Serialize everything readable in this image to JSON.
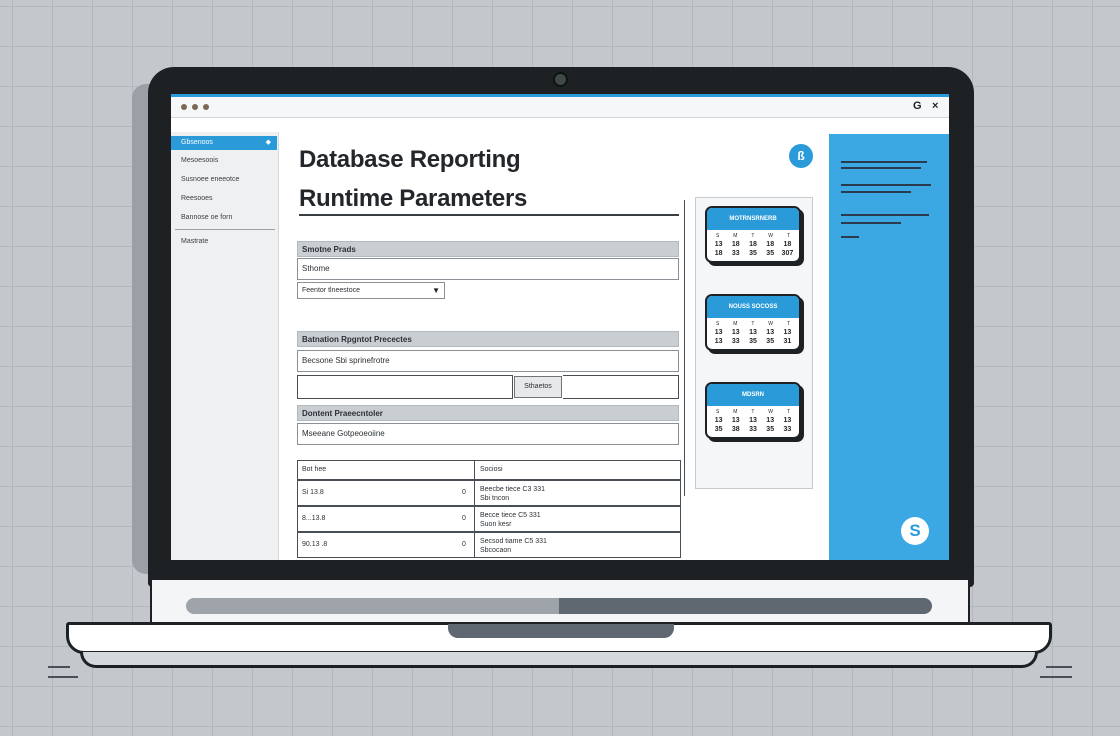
{
  "window": {
    "controls_right": [
      "G",
      "×"
    ]
  },
  "sidebar": {
    "items": [
      {
        "label": "Gbsenoos",
        "active": true
      },
      {
        "label": "Mesoesoois"
      },
      {
        "label": "Susnoee eneeotce"
      },
      {
        "label": "Reesooes"
      },
      {
        "label": "Bannose oe forn"
      },
      {
        "label": "Mastrate"
      }
    ]
  },
  "main": {
    "title_line1": "Database Reporting",
    "title_line2": "Runtime Parameters",
    "help_icon_glyph": "ß",
    "section1": {
      "header": "Smotne Prads",
      "field_value": "Sthome",
      "select_value": "Feentor tlneestoce"
    },
    "section2": {
      "header": "Batnation Rpgntot Precectes",
      "field_value": "Becsone Sbi sprinefrotre",
      "button_label": "Sthaetos"
    },
    "section3": {
      "header": "Dontent Praeecntoler",
      "field_value": "Mseeane Gotpeoeoiine"
    },
    "table": {
      "headers": [
        "Bot hee",
        "Sociosi"
      ],
      "rows": [
        {
          "left": "Si 13.8",
          "marker": "0",
          "right": "Beecbe tiece C3 331",
          "right_sub": "Sbi tncon"
        },
        {
          "left": "8...13.8",
          "marker": "0",
          "right": "Becce tiece C5 331",
          "right_sub": "Suon kesr"
        },
        {
          "left": "90.13 .8",
          "marker": "0",
          "right": "Secsod tiame C5 331",
          "right_sub": "Sbcocaon"
        }
      ]
    }
  },
  "calendars": [
    {
      "title": "MOTRNSRNERB",
      "weekdays": [
        "S",
        "M",
        "T",
        "W",
        "T"
      ],
      "dates": [
        "13",
        "18",
        "18",
        "18",
        "18",
        "18",
        "33",
        "35",
        "35",
        "307"
      ]
    },
    {
      "title": "NOUSS SOCOSS",
      "weekdays": [
        "S",
        "M",
        "T",
        "W",
        "T"
      ],
      "dates": [
        "13",
        "13",
        "13",
        "13",
        "13",
        "13",
        "33",
        "35",
        "35",
        "31"
      ]
    },
    {
      "title": "MDSRN",
      "weekdays": [
        "S",
        "M",
        "T",
        "W",
        "T"
      ],
      "dates": [
        "13",
        "13",
        "13",
        "13",
        "13",
        "35",
        "38",
        "33",
        "35",
        "33"
      ]
    }
  ],
  "right_panel": {
    "brand_glyph": "S"
  },
  "colors": {
    "accent": "#2a9bd8",
    "panel_blue": "#3ba7e3",
    "bezel": "#1e2124",
    "grid_background": "#c4c8cc"
  }
}
